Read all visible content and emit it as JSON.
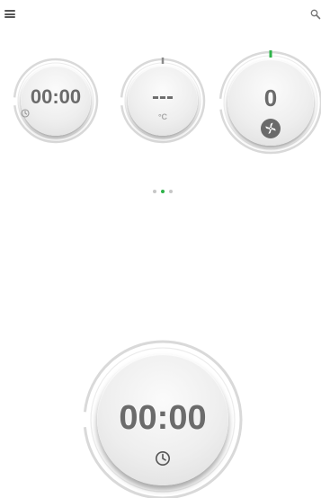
{
  "topbar": {
    "menu_icon": "hamburger-menu-icon",
    "search_icon": "search-icon"
  },
  "dials": {
    "timer": {
      "value": "00:00",
      "icon": "clock-icon"
    },
    "temperature": {
      "value": "---",
      "unit": "°C"
    },
    "fan": {
      "value": "0",
      "icon": "fan-icon"
    }
  },
  "pager": {
    "count": 3,
    "active_index": 1
  },
  "main_dial": {
    "value": "00:00",
    "icon": "clock-icon"
  },
  "colors": {
    "accent": "#2fb34a",
    "ring": "#d9d9d9",
    "text": "#6b6b6b",
    "icon": "#555555",
    "indicator_gray": "#8a8a8a"
  }
}
